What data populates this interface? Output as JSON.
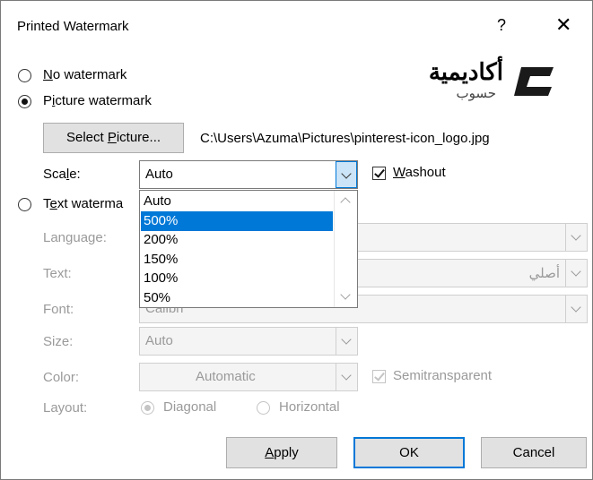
{
  "dialog": {
    "title": "Printed Watermark",
    "help_label": "?",
    "close_label": "✕"
  },
  "logo": {
    "arabic_name": "أكاديمية",
    "arabic_sub": "حسوب"
  },
  "options": {
    "no_watermark": {
      "pre": "",
      "ul": "N",
      "post": "o watermark"
    },
    "picture_watermark": {
      "pre": "P",
      "ul": "i",
      "post": "cture watermark"
    },
    "text_watermark": {
      "pre": "T",
      "ul": "e",
      "post": "xt waterma"
    },
    "selected": "picture_watermark"
  },
  "picture": {
    "select_button": {
      "pre": "Select ",
      "ul": "P",
      "post": "icture..."
    },
    "path": "C:\\Users\\Azuma\\Pictures\\pinterest-icon_logo.jpg",
    "scale_label": {
      "pre": "Sca",
      "ul": "l",
      "post": "e:"
    },
    "scale_value": "Auto",
    "washout": {
      "pre": "",
      "ul": "W",
      "post": "ashout",
      "checked": true
    }
  },
  "scale_dropdown": {
    "options": [
      "Auto",
      "500%",
      "200%",
      "150%",
      "100%",
      "50%"
    ],
    "selected_index": 1
  },
  "text_section": {
    "language_label": "Language:",
    "text_label": "Text:",
    "text_value": "أصلي",
    "font_label": "Font:",
    "font_value": "Calibri",
    "size_label": "Size:",
    "size_value": "Auto",
    "color_label": "Color:",
    "color_value": "Automatic",
    "semitransparent_label": "Semitransparent",
    "semitransparent_checked": true,
    "layout_label": "Layout:",
    "layout_diagonal": "Diagonal",
    "layout_horizontal": "Horizontal",
    "layout_selected": "diagonal"
  },
  "buttons": {
    "apply": {
      "pre": "",
      "ul": "A",
      "post": "pply"
    },
    "ok": "OK",
    "cancel": "Cancel"
  },
  "colors": {
    "accent": "#0078d7",
    "disabled_text": "#9a9a9a",
    "button_face": "#e1e1e1"
  }
}
